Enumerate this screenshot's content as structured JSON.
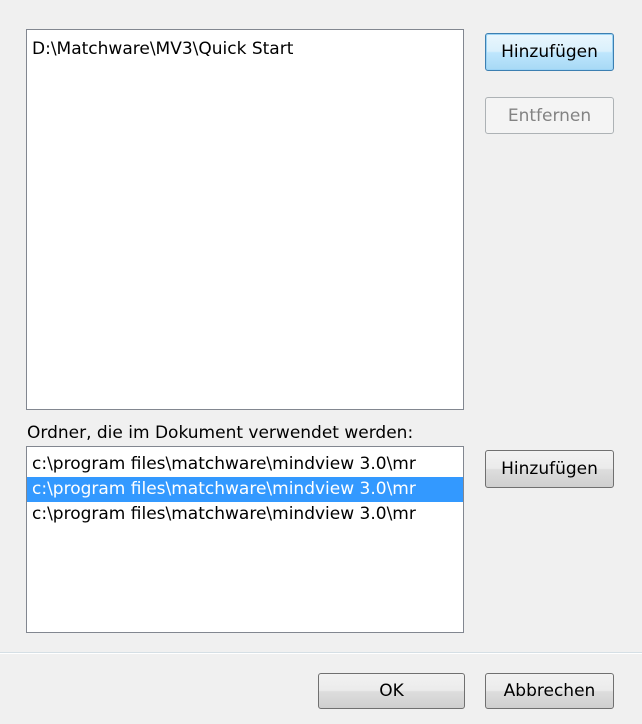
{
  "search_paths": {
    "items": [
      "D:\\Matchware\\MV3\\Quick Start"
    ],
    "add_label": "Hinzufügen",
    "remove_label": "Entfernen"
  },
  "document_folders": {
    "label": "Ordner, die im Dokument verwendet werden:",
    "items": [
      "c:\\program files\\matchware\\mindview 3.0\\mr",
      "c:\\program files\\matchware\\mindview 3.0\\mr",
      "c:\\program files\\matchware\\mindview 3.0\\mr"
    ],
    "selected_index": 1,
    "add_label": "Hinzufügen"
  },
  "footer": {
    "ok_label": "OK",
    "cancel_label": "Abbrechen"
  },
  "colors": {
    "dialog_background": "#f0f0f0",
    "selection_background": "#3399ff",
    "selection_text": "#ffffff",
    "disabled_text": "#838383"
  }
}
